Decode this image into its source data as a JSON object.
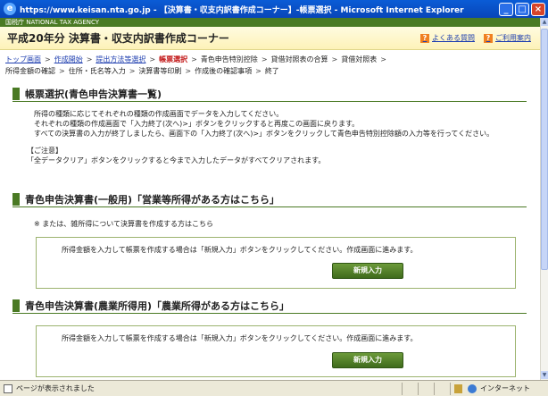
{
  "window": {
    "title": "https://www.keisan.nta.go.jp - 【決算書・収支内訳書作成コーナー】-帳票選択 - Microsoft Internet Explorer",
    "ie_glyph": "e",
    "min": "_",
    "max": "□",
    "close": "×"
  },
  "agency": {
    "label": "国税庁 NATIONAL TAX AGENCY"
  },
  "header": {
    "title": "平成20年分 決算書・収支内訳書作成コーナー",
    "faq": "よくある質問",
    "guide": "ご利用案内",
    "q_glyph": "?"
  },
  "breadcrumb": {
    "top": "トップ画面",
    "start": "作成開始",
    "method": "提出方法等選択",
    "current": "帳票選択",
    "blue_deduction": "青色申告特別控除",
    "bs_total": "貸借対照表の合算",
    "bs": "貸借対照表",
    "income_check": "所得金額の確認",
    "address": "住所・氏名等入力",
    "print": "決算書等印刷",
    "after_check": "作成後の確認事項",
    "end": "終了",
    "sep": ">"
  },
  "section1": {
    "title": "帳票選択(青色申告決算書一覧)",
    "lines": [
      "所得の種類に応じてそれぞれの種類の作成画面でデータを入力してください。",
      "それぞれの種類の作成画面で「入力終了(次へ)>」ボタンをクリックすると再度この画面に戻ります。",
      "すべての決算書の入力が終了しましたら、画面下の「入力終了(次へ)>」ボタンをクリックして青色申告特別控除額の入力等を行ってください。"
    ],
    "caution_title": "【ご注意】",
    "caution_text": "「全データクリア」ボタンをクリックすると今まで入力したデータがすべてクリアされます。"
  },
  "section2": {
    "title": "青色申告決算書(一般用)「営業等所得がある方はこちら」",
    "note": "※  または、雑所得について決算書を作成する方はこちら",
    "panel_text": "所得金額を入力して帳票を作成する場合は「新規入力」ボタンをクリックしてください。作成画面に進みます。",
    "button": "新規入力"
  },
  "section3": {
    "title": "青色申告決算書(農業所得用)「農業所得がある方はこちら」",
    "panel_text": "所得金額を入力して帳票を作成する場合は「新規入力」ボタンをクリックしてください。作成画面に進みます。",
    "button": "新規入力"
  },
  "status": {
    "left": "ページが表示されました",
    "zone": "インターネット"
  },
  "scroll": {
    "up": "▲",
    "down": "▼"
  },
  "colors": {
    "accent_green": "#4a7a24",
    "title_blue": "#0a5cd6",
    "current_red": "#c01010"
  }
}
